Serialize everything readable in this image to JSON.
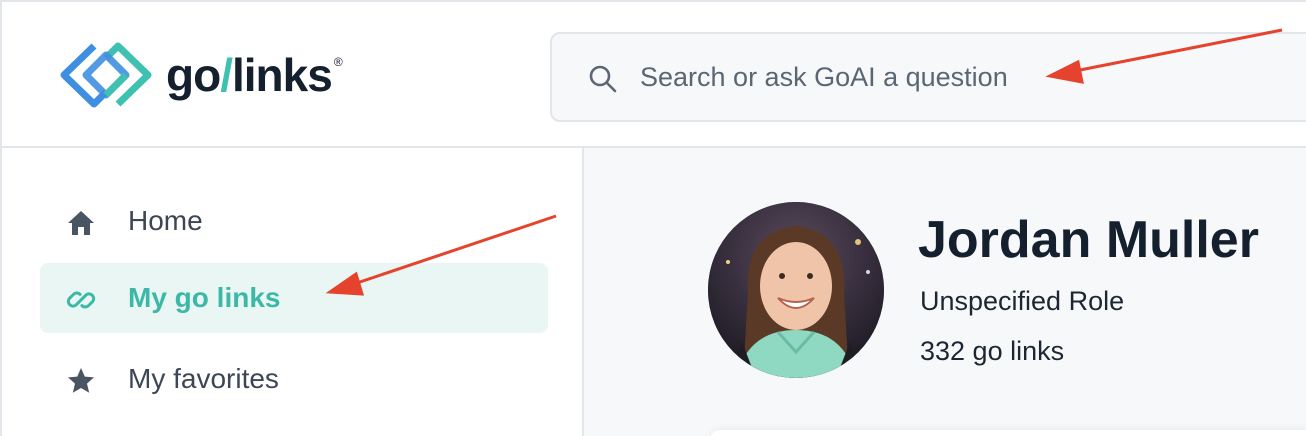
{
  "brand": {
    "name_part1": "go",
    "slash": "/",
    "name_part2": "links",
    "registered": "®",
    "colors": {
      "blue": "#3f8fe0",
      "teal": "#3ec1b0",
      "dark": "#15202e"
    }
  },
  "search": {
    "placeholder": "Search or ask GoAI a question",
    "icon": "search-icon"
  },
  "sidebar": {
    "items": [
      {
        "label": "Home",
        "icon": "home-icon",
        "active": false
      },
      {
        "label": "My go links",
        "icon": "link-icon",
        "active": true
      },
      {
        "label": "My favorites",
        "icon": "star-icon",
        "active": false
      }
    ],
    "active_color": "#3cb8a6",
    "active_bg": "#e9f6f3"
  },
  "profile": {
    "name": "Jordan Muller",
    "role": "Unspecified Role",
    "link_count": "332 go links"
  },
  "annotations": {
    "arrow_color": "#e5432d"
  }
}
